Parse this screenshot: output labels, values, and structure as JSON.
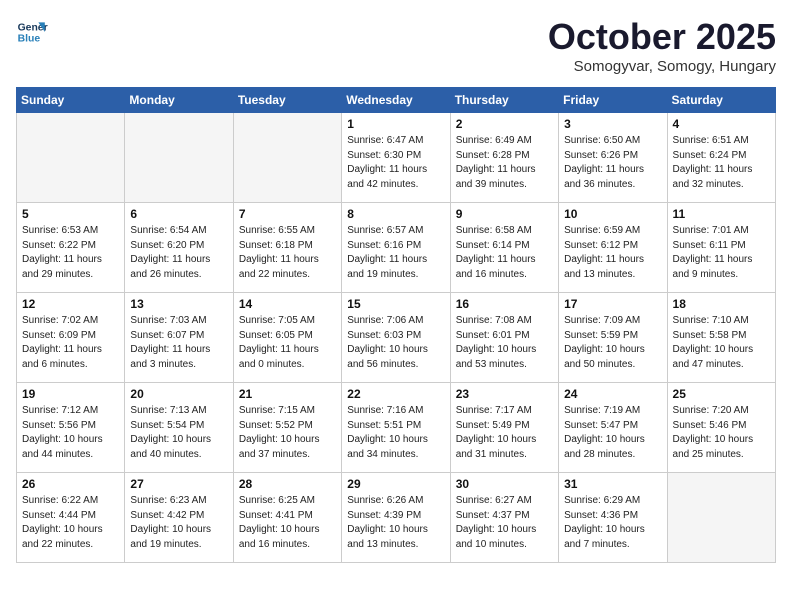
{
  "logo": {
    "line1": "General",
    "line2": "Blue"
  },
  "title": "October 2025",
  "subtitle": "Somogyvar, Somogy, Hungary",
  "days_of_week": [
    "Sunday",
    "Monday",
    "Tuesday",
    "Wednesday",
    "Thursday",
    "Friday",
    "Saturday"
  ],
  "weeks": [
    [
      {
        "day": "",
        "info": ""
      },
      {
        "day": "",
        "info": ""
      },
      {
        "day": "",
        "info": ""
      },
      {
        "day": "1",
        "info": "Sunrise: 6:47 AM\nSunset: 6:30 PM\nDaylight: 11 hours\nand 42 minutes."
      },
      {
        "day": "2",
        "info": "Sunrise: 6:49 AM\nSunset: 6:28 PM\nDaylight: 11 hours\nand 39 minutes."
      },
      {
        "day": "3",
        "info": "Sunrise: 6:50 AM\nSunset: 6:26 PM\nDaylight: 11 hours\nand 36 minutes."
      },
      {
        "day": "4",
        "info": "Sunrise: 6:51 AM\nSunset: 6:24 PM\nDaylight: 11 hours\nand 32 minutes."
      }
    ],
    [
      {
        "day": "5",
        "info": "Sunrise: 6:53 AM\nSunset: 6:22 PM\nDaylight: 11 hours\nand 29 minutes."
      },
      {
        "day": "6",
        "info": "Sunrise: 6:54 AM\nSunset: 6:20 PM\nDaylight: 11 hours\nand 26 minutes."
      },
      {
        "day": "7",
        "info": "Sunrise: 6:55 AM\nSunset: 6:18 PM\nDaylight: 11 hours\nand 22 minutes."
      },
      {
        "day": "8",
        "info": "Sunrise: 6:57 AM\nSunset: 6:16 PM\nDaylight: 11 hours\nand 19 minutes."
      },
      {
        "day": "9",
        "info": "Sunrise: 6:58 AM\nSunset: 6:14 PM\nDaylight: 11 hours\nand 16 minutes."
      },
      {
        "day": "10",
        "info": "Sunrise: 6:59 AM\nSunset: 6:12 PM\nDaylight: 11 hours\nand 13 minutes."
      },
      {
        "day": "11",
        "info": "Sunrise: 7:01 AM\nSunset: 6:11 PM\nDaylight: 11 hours\nand 9 minutes."
      }
    ],
    [
      {
        "day": "12",
        "info": "Sunrise: 7:02 AM\nSunset: 6:09 PM\nDaylight: 11 hours\nand 6 minutes."
      },
      {
        "day": "13",
        "info": "Sunrise: 7:03 AM\nSunset: 6:07 PM\nDaylight: 11 hours\nand 3 minutes."
      },
      {
        "day": "14",
        "info": "Sunrise: 7:05 AM\nSunset: 6:05 PM\nDaylight: 11 hours\nand 0 minutes."
      },
      {
        "day": "15",
        "info": "Sunrise: 7:06 AM\nSunset: 6:03 PM\nDaylight: 10 hours\nand 56 minutes."
      },
      {
        "day": "16",
        "info": "Sunrise: 7:08 AM\nSunset: 6:01 PM\nDaylight: 10 hours\nand 53 minutes."
      },
      {
        "day": "17",
        "info": "Sunrise: 7:09 AM\nSunset: 5:59 PM\nDaylight: 10 hours\nand 50 minutes."
      },
      {
        "day": "18",
        "info": "Sunrise: 7:10 AM\nSunset: 5:58 PM\nDaylight: 10 hours\nand 47 minutes."
      }
    ],
    [
      {
        "day": "19",
        "info": "Sunrise: 7:12 AM\nSunset: 5:56 PM\nDaylight: 10 hours\nand 44 minutes."
      },
      {
        "day": "20",
        "info": "Sunrise: 7:13 AM\nSunset: 5:54 PM\nDaylight: 10 hours\nand 40 minutes."
      },
      {
        "day": "21",
        "info": "Sunrise: 7:15 AM\nSunset: 5:52 PM\nDaylight: 10 hours\nand 37 minutes."
      },
      {
        "day": "22",
        "info": "Sunrise: 7:16 AM\nSunset: 5:51 PM\nDaylight: 10 hours\nand 34 minutes."
      },
      {
        "day": "23",
        "info": "Sunrise: 7:17 AM\nSunset: 5:49 PM\nDaylight: 10 hours\nand 31 minutes."
      },
      {
        "day": "24",
        "info": "Sunrise: 7:19 AM\nSunset: 5:47 PM\nDaylight: 10 hours\nand 28 minutes."
      },
      {
        "day": "25",
        "info": "Sunrise: 7:20 AM\nSunset: 5:46 PM\nDaylight: 10 hours\nand 25 minutes."
      }
    ],
    [
      {
        "day": "26",
        "info": "Sunrise: 6:22 AM\nSunset: 4:44 PM\nDaylight: 10 hours\nand 22 minutes."
      },
      {
        "day": "27",
        "info": "Sunrise: 6:23 AM\nSunset: 4:42 PM\nDaylight: 10 hours\nand 19 minutes."
      },
      {
        "day": "28",
        "info": "Sunrise: 6:25 AM\nSunset: 4:41 PM\nDaylight: 10 hours\nand 16 minutes."
      },
      {
        "day": "29",
        "info": "Sunrise: 6:26 AM\nSunset: 4:39 PM\nDaylight: 10 hours\nand 13 minutes."
      },
      {
        "day": "30",
        "info": "Sunrise: 6:27 AM\nSunset: 4:37 PM\nDaylight: 10 hours\nand 10 minutes."
      },
      {
        "day": "31",
        "info": "Sunrise: 6:29 AM\nSunset: 4:36 PM\nDaylight: 10 hours\nand 7 minutes."
      },
      {
        "day": "",
        "info": ""
      }
    ]
  ]
}
